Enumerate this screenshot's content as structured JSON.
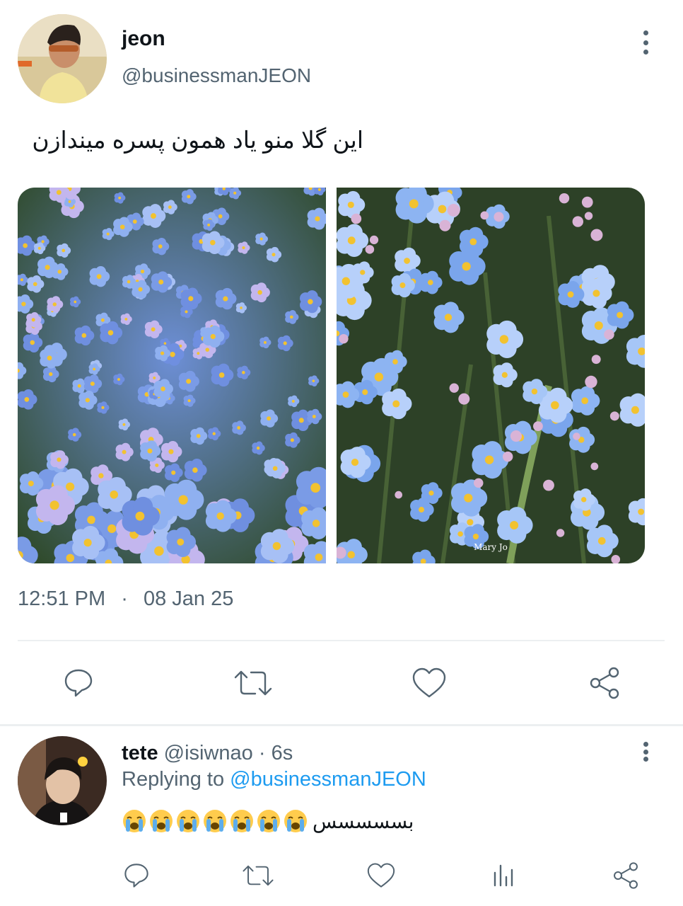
{
  "tweet": {
    "author_name": "jeon",
    "author_handle": "@businessmanJEON",
    "text": "این گلا منو یاد همون پسره میندازن",
    "time": "12:51 PM",
    "separator": "·",
    "date": "08 Jan 25",
    "photos": [
      "forget-me-not flowers photo 1",
      "forget-me-not flowers photo 2"
    ],
    "watermark": "Mary Jo"
  },
  "actions": {
    "reply_icon": "reply-icon",
    "retweet_icon": "retweet-icon",
    "like_icon": "heart-icon",
    "share_icon": "share-icon"
  },
  "reply": {
    "author_name": "tete",
    "author_handle": "@isiwnao",
    "separator": "·",
    "time_ago": "6s",
    "replying_prefix": "Replying to",
    "replying_handle": "@businessmanJEON",
    "text": "بسسسسس",
    "emoji_count": 7,
    "emoji_name": "loudly-crying-face"
  },
  "reply_actions": {
    "reply_icon": "reply-icon",
    "retweet_icon": "retweet-icon",
    "like_icon": "heart-icon",
    "stats_icon": "analytics-icon",
    "share_icon": "share-icon"
  },
  "colors": {
    "accent": "#1d9bf0",
    "muted": "#536471",
    "text": "#0f1419",
    "divider": "#eceff1"
  }
}
